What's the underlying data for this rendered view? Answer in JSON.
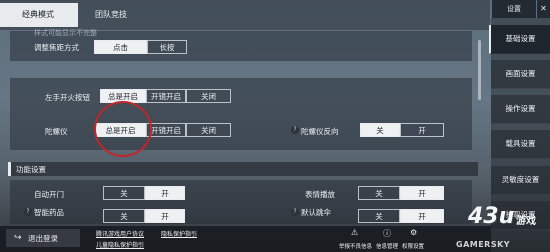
{
  "tabs": {
    "classic": "经典模式",
    "team": "团队竞技"
  },
  "top": {
    "settings_btn": "设置"
  },
  "section1": {
    "cut_label": "样式可能显示不完整",
    "focus_label": "调整焦距方式",
    "focus_click": "点击",
    "focus_hold": "长按"
  },
  "section2": {
    "left_fire_label": "左手开火按钮",
    "left_fire_opts": [
      "总是开启",
      "开镜开启",
      "关闭"
    ],
    "gyro_label": "陀螺仪",
    "gyro_opts": [
      "总是开启",
      "开镜开启",
      "关闭"
    ],
    "gyro_reverse_label": "陀螺仪反向",
    "gyro_reverse_off": "关",
    "gyro_reverse_on": "开"
  },
  "function": {
    "title": "功能设置",
    "auto_door_label": "自动开门",
    "auto_door_off": "关",
    "auto_door_on": "开",
    "emote_label": "表情播放",
    "emote_off": "关",
    "emote_on": "开",
    "smart_med_label": "智能药品",
    "smart_med_off": "关",
    "smart_med_on": "开",
    "default_chute_label": "默认跳伞",
    "default_chute_off": "关",
    "default_chute_on": "开"
  },
  "nav": [
    "基础设置",
    "画面设置",
    "操作设置",
    "载具设置",
    "灵敏度设置",
    "拾取设置"
  ],
  "nav_active": "基础设置",
  "footer": {
    "logout": "退出登录",
    "link1": "腾讯游戏用户协议",
    "link2": "隐私保护指引",
    "link3": "儿童隐私保护指引",
    "report": "举报不良信息",
    "info_mgmt": "信息管理",
    "permission": "权限设置"
  },
  "watermark": {
    "site": "43u",
    "sub": "游戏",
    "brand": "GAMERSKY"
  },
  "colors": {
    "annotation": "#c0262a",
    "active_option": "#eef0f2"
  }
}
